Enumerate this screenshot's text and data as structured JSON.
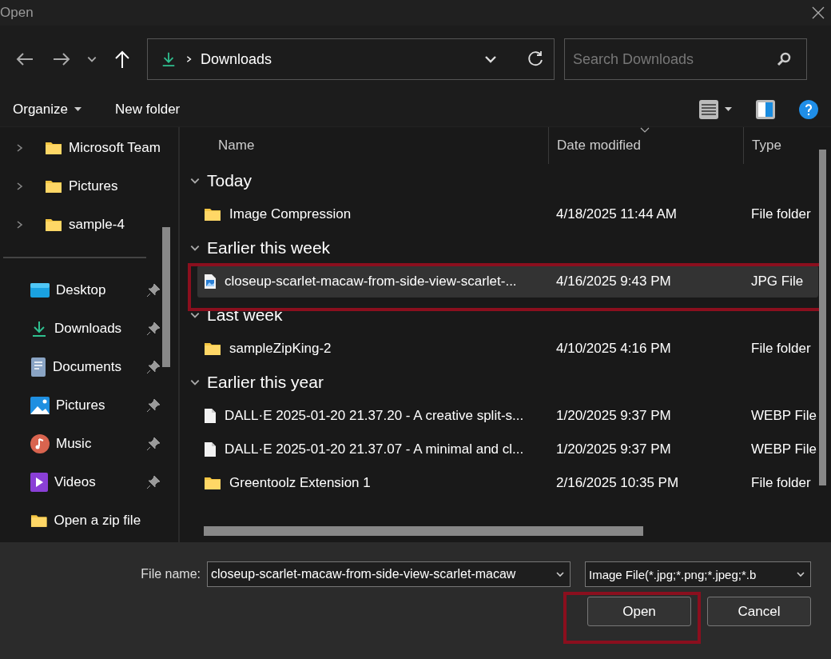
{
  "window": {
    "title": "Open"
  },
  "navigation": {
    "path": "Downloads",
    "search": {
      "placeholder": "Search Downloads"
    }
  },
  "commands": {
    "organize": "Organize",
    "new_folder": "New folder"
  },
  "sidebar": {
    "tree": [
      {
        "label": "Microsoft Team",
        "expanded": false
      },
      {
        "label": "Pictures",
        "expanded": false
      },
      {
        "label": "sample-4",
        "expanded": false
      }
    ],
    "quick_access": [
      {
        "label": "Desktop",
        "kind": "desktop",
        "pinned": true
      },
      {
        "label": "Downloads",
        "kind": "downloads",
        "pinned": true
      },
      {
        "label": "Documents",
        "kind": "documents",
        "pinned": true
      },
      {
        "label": "Pictures",
        "kind": "pictures",
        "pinned": true
      },
      {
        "label": "Music",
        "kind": "music",
        "pinned": true
      },
      {
        "label": "Videos",
        "kind": "videos",
        "pinned": true
      },
      {
        "label": "Open a zip file",
        "kind": "folder",
        "pinned": false
      }
    ]
  },
  "table": {
    "columns": [
      {
        "label": "Name",
        "sorted": false
      },
      {
        "label": "Date modified",
        "sorted": true
      },
      {
        "label": "Type",
        "sorted": false
      }
    ],
    "groups": [
      {
        "label": "Today",
        "expanded": true,
        "files": [
          {
            "name": "Image Compression",
            "date": "4/18/2025 11:44 AM",
            "type": "File folder",
            "kind": "folder",
            "selected": false,
            "highlighted": false
          }
        ]
      },
      {
        "label": "Earlier this week",
        "expanded": true,
        "files": [
          {
            "name": "closeup-scarlet-macaw-from-side-view-scarlet-...",
            "date": "4/16/2025 9:43 PM",
            "type": "JPG File",
            "kind": "image",
            "selected": true,
            "highlighted": true
          }
        ]
      },
      {
        "label": "Last week",
        "expanded": true,
        "files": [
          {
            "name": "sampleZipKing-2",
            "date": "4/10/2025 4:16 PM",
            "type": "File folder",
            "kind": "folder",
            "selected": false,
            "highlighted": false
          }
        ]
      },
      {
        "label": "Earlier this year",
        "expanded": true,
        "files": [
          {
            "name": "DALL·E 2025-01-20 21.37.20 - A creative split-s...",
            "date": "1/20/2025 9:37 PM",
            "type": "WEBP File",
            "kind": "document",
            "selected": false,
            "highlighted": false
          },
          {
            "name": "DALL·E 2025-01-20 21.37.07 - A minimal and cl...",
            "date": "1/20/2025 9:37 PM",
            "type": "WEBP File",
            "kind": "document",
            "selected": false,
            "highlighted": false
          },
          {
            "name": "Greentoolz Extension 1",
            "date": "2/16/2025 10:35 PM",
            "type": "File folder",
            "kind": "folder",
            "selected": false,
            "highlighted": false
          }
        ]
      }
    ]
  },
  "footer": {
    "file_name_label": "File name:",
    "file_name": "closeup-scarlet-macaw-from-side-view-scarlet-macaw",
    "filter": "Image File(*.jpg;*.png;*.jpeg;*.b",
    "buttons": [
      {
        "label": "Open",
        "highlighted": true
      },
      {
        "label": "Cancel",
        "highlighted": false
      }
    ]
  }
}
